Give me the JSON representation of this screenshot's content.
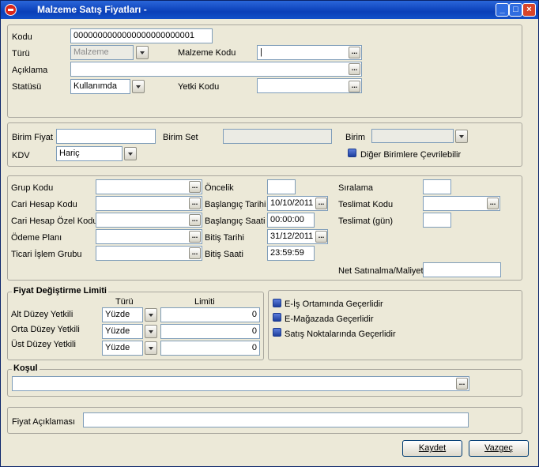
{
  "window": {
    "title": "Malzeme Satış Fiyatları -",
    "min": "_",
    "max": "□",
    "close": "×"
  },
  "main": {
    "kodu_label": "Kodu",
    "kodu_value": "0000000000000000000000001",
    "turu_label": "Türü",
    "turu_value": "Malzeme",
    "malzeme_kodu_label": "Malzeme Kodu",
    "malzeme_kodu_value": "|",
    "aciklama_label": "Açıklama",
    "aciklama_value": "",
    "statusu_label": "Statüsü",
    "statusu_value": "Kullanımda",
    "yetki_kodu_label": "Yetki Kodu",
    "yetki_kodu_value": ""
  },
  "unit": {
    "birim_fiyat_label": "Birim Fiyat",
    "birim_fiyat_value": "",
    "birim_set_label": "Birim Set",
    "birim_set_value": "",
    "birim_label": "Birim",
    "birim_value": "",
    "kdv_label": "KDV",
    "kdv_value": "Hariç",
    "diger_label": "Diğer Birimlere Çevrilebilir"
  },
  "details": {
    "grup_kodu": "Grup Kodu",
    "cari_hesap_kodu": "Cari Hesap Kodu",
    "cari_hesap_ozel_kodu": "Cari Hesap Özel Kodu",
    "odeme_plani": "Ödeme Planı",
    "ticari_islem_grubu": "Ticari İşlem Grubu",
    "oncelik": "Öncelik",
    "baslangic_tarihi": "Başlangıç Tarihi",
    "baslangic_tarihi_value": "10/10/2011",
    "baslangic_saati": "Başlangıç Saati",
    "baslangic_saati_value": "00:00:00",
    "bitis_tarihi": "Bitiş Tarihi",
    "bitis_tarihi_value": "31/12/2011",
    "bitis_saati": "Bitiş Saati",
    "bitis_saati_value": "23:59:59",
    "siralama": "Sıralama",
    "teslimat_kodu": "Teslimat Kodu",
    "teslimat_gun": "Teslimat (gün)",
    "net_satinalma": "Net Satınalma/Maliyet"
  },
  "limits": {
    "title": "Fiyat Değiştirme Limiti",
    "col_turu": "Türü",
    "col_limiti": "Limiti",
    "rows": [
      {
        "label": "Alt Düzey Yetkili",
        "type": "Yüzde",
        "value": "0"
      },
      {
        "label": "Orta Düzey Yetkili",
        "type": "Yüzde",
        "value": "0"
      },
      {
        "label": "Üst Düzey Yetkili",
        "type": "Yüzde",
        "value": "0"
      }
    ]
  },
  "validity": {
    "eis": "E-İş Ortamında Geçerlidir",
    "emagaza": "E-Mağazada Geçerlidir",
    "satis": "Satış Noktalarında Geçerlidir"
  },
  "kosul": {
    "title": "Koşul",
    "value": ""
  },
  "fiyat_aciklamasi": {
    "label": "Fiyat Açıklaması",
    "value": ""
  },
  "buttons": {
    "kaydet": "Kaydet",
    "vazgec": "Vazgeç"
  },
  "icons": {
    "browse": "...",
    "accent": "#0a3fb8"
  }
}
